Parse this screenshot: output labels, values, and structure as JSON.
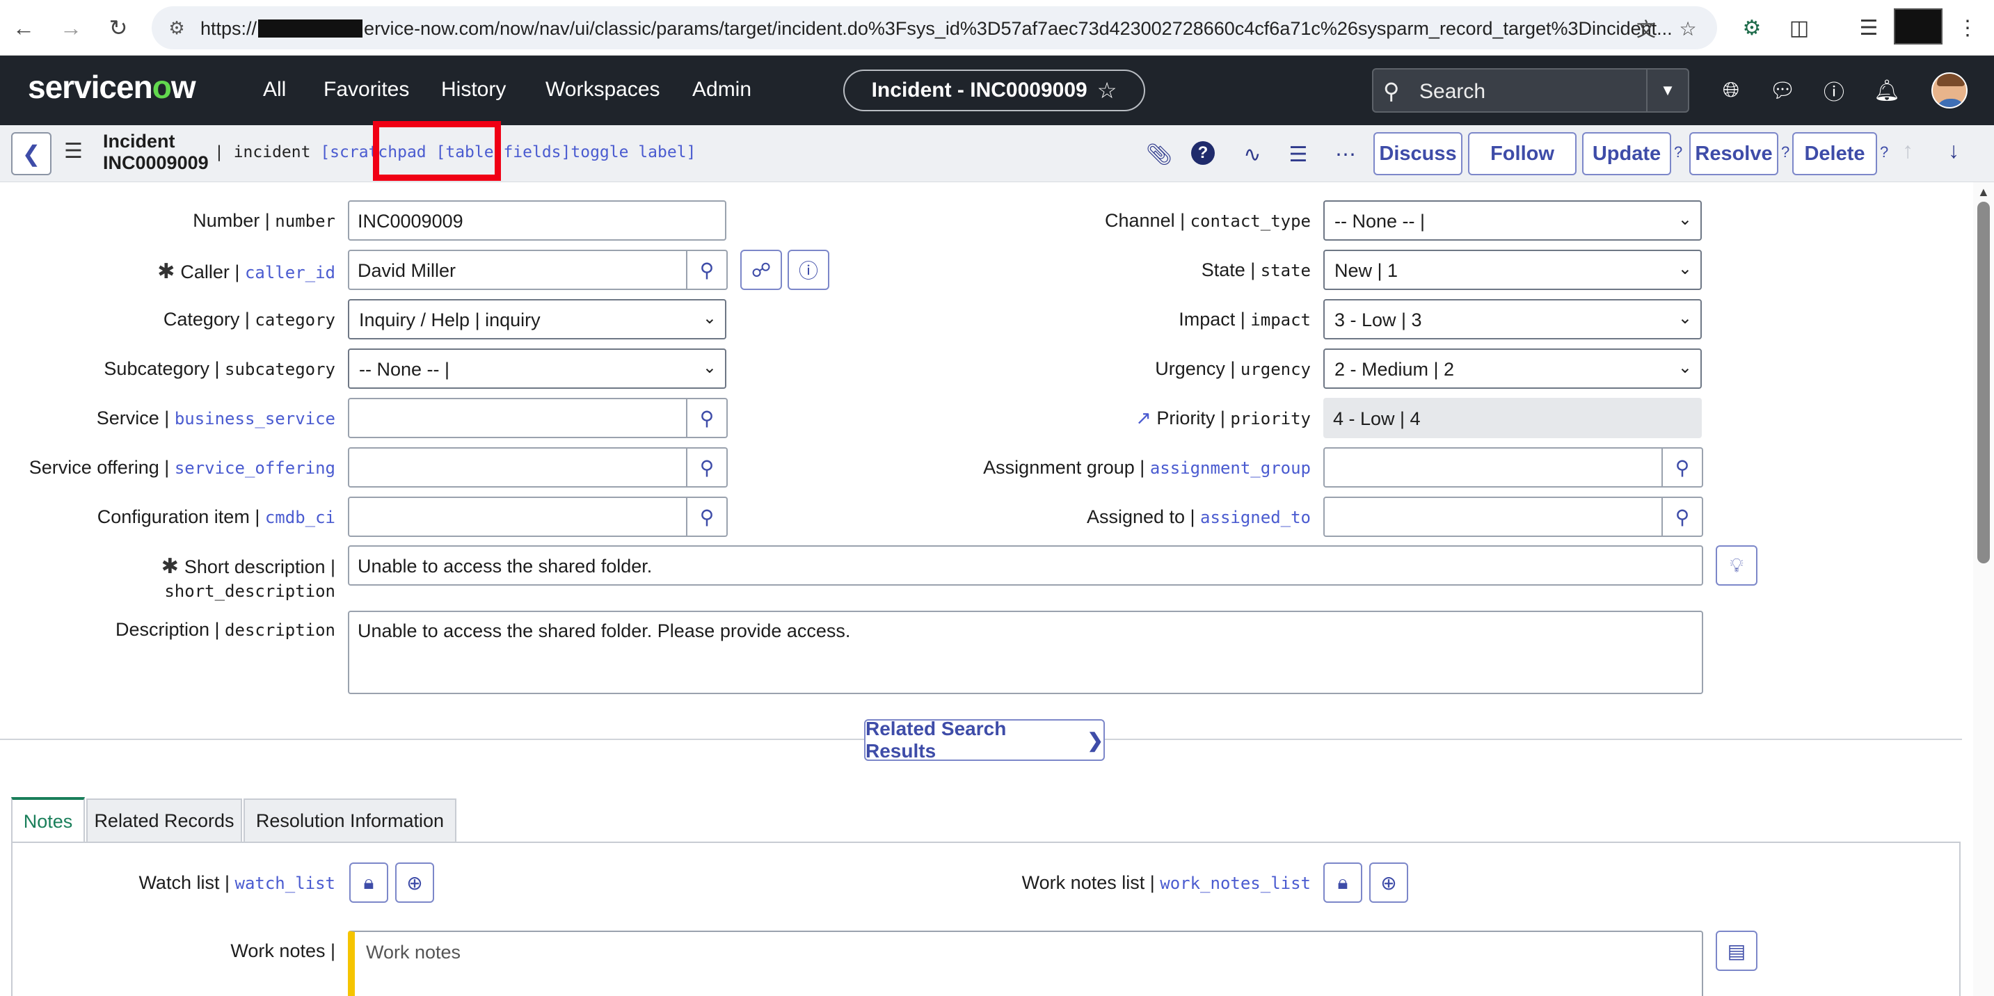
{
  "browser": {
    "url_prefix": "https://",
    "url_suffix": "ervice-now.com/now/nav/ui/classic/params/target/incident.do%3Fsys_id%3D57af7aec73d423002728660c4cf6a71c%26sysparm_record_target%3Dincident..."
  },
  "sn_header": {
    "logo_a": "servicen",
    "logo_o": "o",
    "logo_b": "w",
    "menu": [
      "All",
      "Favorites",
      "History",
      "Workspaces",
      "Admin"
    ],
    "context_title": "Incident - INC0009009",
    "context_star": "☆",
    "search_label": "Search"
  },
  "toolbar": {
    "title_line1": "Incident",
    "title_line2": "INC0009009",
    "table_name": "| incident ",
    "link_scratchpad": "[scratchpad",
    "link_table_fields": "[table fields]",
    "link_toggle_label": "toggle label]",
    "buttons": {
      "discuss": "Discuss",
      "follow": "Follow",
      "update": "Update",
      "resolve": "Resolve",
      "delete": "Delete"
    },
    "help_mark": "?"
  },
  "fields": {
    "number": {
      "label": "Number | ",
      "code": "number",
      "value": "INC0009009"
    },
    "caller": {
      "label": "Caller | ",
      "code": "caller_id",
      "value": "David Miller"
    },
    "category": {
      "label": "Category | ",
      "code": "category",
      "value": "Inquiry / Help | inquiry"
    },
    "subcategory": {
      "label": "Subcategory | ",
      "code": "subcategory",
      "value": "-- None -- |"
    },
    "service": {
      "label": "Service | ",
      "code": "business_service",
      "value": ""
    },
    "service_offering": {
      "label": "Service offering | ",
      "code": "service_offering",
      "value": ""
    },
    "cmdb_ci": {
      "label": "Configuration item | ",
      "code": "cmdb_ci",
      "value": ""
    },
    "short_description": {
      "label": "Short description | ",
      "code": "short_description",
      "value": "Unable to access the shared folder."
    },
    "description": {
      "label": "Description | ",
      "code": "description",
      "value": "Unable to access the shared folder. Please provide access."
    },
    "channel": {
      "label": "Channel | ",
      "code": "contact_type",
      "value": "-- None -- |"
    },
    "state": {
      "label": "State | ",
      "code": "state",
      "value": "New | 1"
    },
    "impact": {
      "label": "Impact | ",
      "code": "impact",
      "value": "3 - Low | 3"
    },
    "urgency": {
      "label": "Urgency | ",
      "code": "urgency",
      "value": "2 - Medium | 2"
    },
    "priority": {
      "label": "Priority | ",
      "code": "priority",
      "value": "4 - Low | 4"
    },
    "assignment_group": {
      "label": "Assignment group | ",
      "code": "assignment_group",
      "value": ""
    },
    "assigned_to": {
      "label": "Assigned to | ",
      "code": "assigned_to",
      "value": ""
    }
  },
  "related_search": "Related Search Results",
  "tabs": [
    "Notes",
    "Related Records",
    "Resolution Information"
  ],
  "notes": {
    "watch_list": {
      "label": "Watch list | ",
      "code": "watch_list"
    },
    "work_notes_list": {
      "label": "Work notes list | ",
      "code": "work_notes_list"
    },
    "work_notes_label": "Work notes |",
    "work_notes_placeholder": "Work notes"
  },
  "required_mark": "✱",
  "colors": {
    "header_bg": "#1f242b",
    "logo_accent": "#62d84e",
    "link": "#4a5bd0",
    "button_text": "#3e4ca8",
    "highlight": "#f00014",
    "active_tab": "#1a7f5a",
    "work_notes_bar": "#f5c400"
  }
}
